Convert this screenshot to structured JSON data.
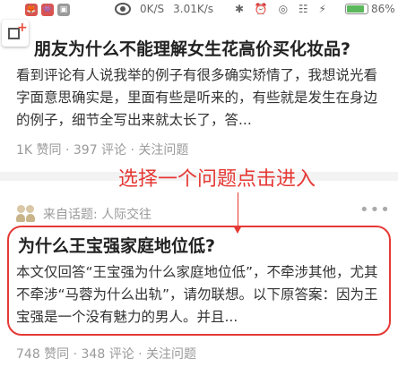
{
  "status_bar": {
    "app_icon_1": "🦊",
    "app_icon_2": "👾",
    "app_icon_3": "▣",
    "speed_label": "0K/S",
    "speed_value": "3.01K/s",
    "icons_text": "✱ ⏰ ◎ ☷ ⚡",
    "battery_percent": 86,
    "battery_label": "86%",
    "battery_color": "#5cb85c"
  },
  "card1": {
    "title": "朋友为什么不能理解女生花高价买化妆品?",
    "excerpt": "看到评论有人说我举的例子有很多确实矫情了，我想说光看字面意思确实是，里面有些是听来的，有些就是发生在身边的例子，细节全写出来就太长了，答...",
    "meta": "1K 赞同 · 397 评论 · 关注问题"
  },
  "card2": {
    "topic": "来自话题: 人际交往",
    "more": "•••",
    "title": "为什么王宝强家庭地位低?",
    "excerpt": "本文仅回答“王宝强为什么家庭地位低”，不牵涉其他，尤其不牵涉“马蓉为什么出轨”，请勿联想。以下原答案：因为王宝强是一个没有魅力的男人。并且...",
    "meta": "748 赞同 · 348 评论 · 关注问题"
  },
  "annotation": {
    "text": "选择一个问题点击进入",
    "color": "#e53935"
  }
}
